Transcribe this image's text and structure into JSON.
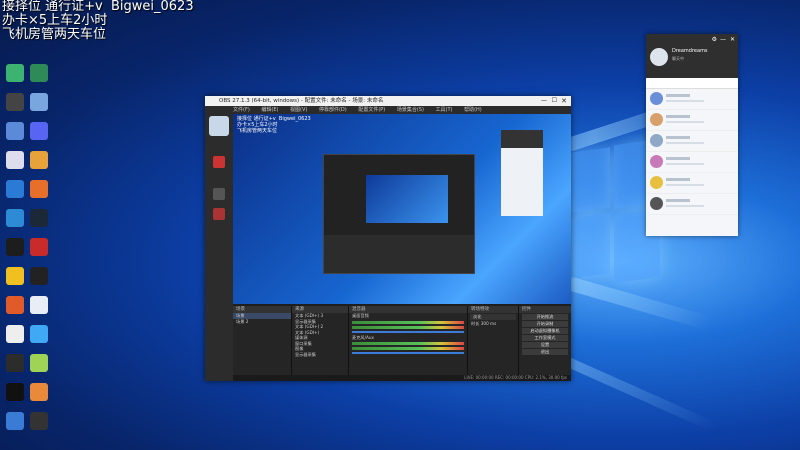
{
  "overlay": {
    "line1": "接择位 通行证+v  Bigwei_0623",
    "line2": "办卡×5上车2小时",
    "line3": "飞机房管两天车位"
  },
  "desktop_icons": [
    {
      "name": "icon-1",
      "color": "#3cb371"
    },
    {
      "name": "icon-2",
      "color": "#2e8b57"
    },
    {
      "name": "icon-3",
      "color": "#444"
    },
    {
      "name": "icon-4",
      "color": "#7aa6e0"
    },
    {
      "name": "icon-5",
      "color": "#5a8ad8"
    },
    {
      "name": "icon-6",
      "color": "#5865f2"
    },
    {
      "name": "icon-7",
      "color": "#dde"
    },
    {
      "name": "icon-8",
      "color": "#e8a23a"
    },
    {
      "name": "icon-9",
      "color": "#2b7bd6"
    },
    {
      "name": "icon-10",
      "color": "#e76f2a"
    },
    {
      "name": "icon-11",
      "color": "#2d8bd6"
    },
    {
      "name": "icon-12",
      "color": "#1b2838"
    },
    {
      "name": "icon-13",
      "color": "#1d1d1d"
    },
    {
      "name": "icon-14",
      "color": "#c92a2a"
    },
    {
      "name": "icon-15",
      "color": "#f0c020"
    },
    {
      "name": "icon-16",
      "color": "#222"
    },
    {
      "name": "icon-17",
      "color": "#e05a2a"
    },
    {
      "name": "icon-18",
      "color": "#e9eef6"
    },
    {
      "name": "icon-19",
      "color": "#eee"
    },
    {
      "name": "icon-20",
      "color": "#3fa9f5"
    },
    {
      "name": "icon-21",
      "color": "#2c2c2c"
    },
    {
      "name": "icon-22",
      "color": "#9fd356"
    },
    {
      "name": "icon-23",
      "color": "#111"
    },
    {
      "name": "icon-24",
      "color": "#e98a3a"
    },
    {
      "name": "icon-25",
      "color": "#3a7bd5"
    },
    {
      "name": "icon-26",
      "color": "#333"
    }
  ],
  "obs": {
    "title": "OBS 27.1.3 (64-bit, windows) - 配置文件: 未命名 - 场景: 未命名",
    "menu": [
      "文件(F)",
      "编辑(E)",
      "视图(V)",
      "停靠部件(D)",
      "配置文件(P)",
      "场景集合(S)",
      "工具(T)",
      "帮助(H)"
    ],
    "panels": {
      "scenes": {
        "title": "场景",
        "items": [
          "场景",
          "场景 2"
        ]
      },
      "sources": {
        "title": "来源",
        "items": [
          "文本 (GDI+) 3",
          "显示器采集",
          "文本 (GDI+) 2",
          "文本 (GDI+)",
          "媒体源",
          "窗口采集",
          "图像",
          "显示器采集"
        ]
      },
      "mixer": {
        "title": "混音器",
        "channels": [
          "桌面音频",
          "麦克风/Aux"
        ]
      },
      "transitions": {
        "title": "转场特效",
        "mode": "淡化",
        "duration_label": "时长",
        "duration": "300 ms"
      },
      "controls": {
        "title": "控件",
        "buttons": [
          "开始推流",
          "开始录制",
          "启动虚拟摄像机",
          "工作室模式",
          "设置",
          "退出"
        ]
      }
    },
    "status": "LIVE: 00:00:00  REC: 00:00:00  CPU: 2.1%, 30.00 fps"
  },
  "chat": {
    "username": "Dreamdreams",
    "status_line": "聊天中",
    "contacts": [
      {
        "name": "",
        "msg": "",
        "color": "#6a8fd8"
      },
      {
        "name": "",
        "msg": "",
        "color": "#d8a06a"
      },
      {
        "name": "",
        "msg": "",
        "color": "#8fa8c8"
      },
      {
        "name": "",
        "msg": "",
        "color": "#c87ab8"
      },
      {
        "name": "",
        "msg": "",
        "color": "#e8c040"
      },
      {
        "name": "",
        "msg": "",
        "color": "#555"
      }
    ]
  }
}
